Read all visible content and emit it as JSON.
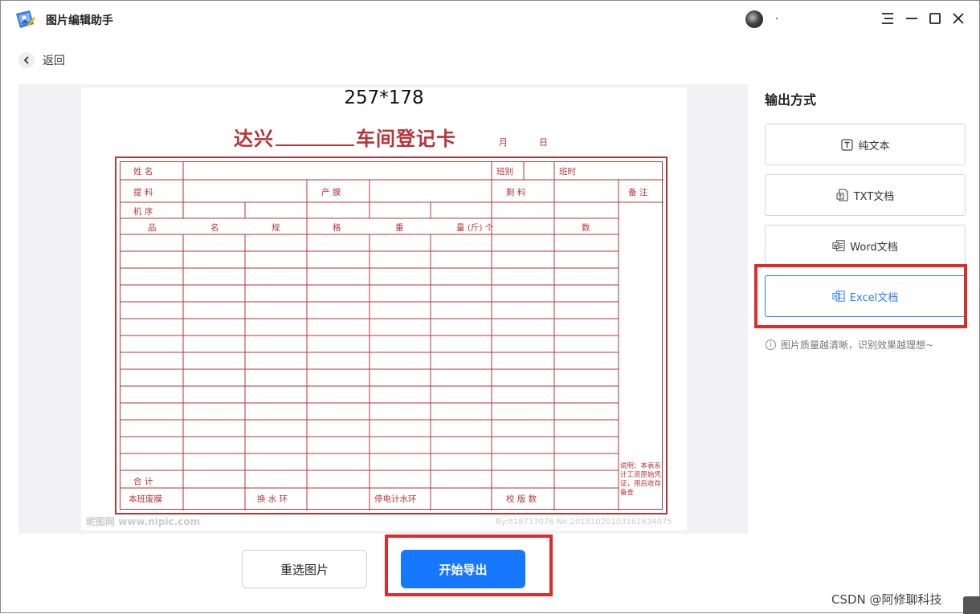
{
  "app": {
    "title": "图片编辑助手",
    "user_name": "."
  },
  "nav": {
    "back_label": "返回"
  },
  "document": {
    "dimensions": "257*178",
    "form_title_left": "达兴",
    "form_title_right": "车间登记卡",
    "month": "月",
    "day": "日",
    "labels": {
      "name": "姓 名",
      "shift": "班别",
      "team_hours": "班时",
      "material": "提 料",
      "output_film": "产 膜",
      "remaining": "剩 料",
      "remarks": "备 注",
      "machine_seq": "机 序",
      "product": "品",
      "name2": "名",
      "spec": "规",
      "format": "格",
      "weight": "重",
      "quantity": "量 (斤) 个",
      "count": "数",
      "total": "合 计",
      "waste_film": "本班废膜",
      "change_ring": "换 水 环",
      "power_cut": "停电计水环",
      "proof_count": "校 版 数",
      "note": "说明：本表系计工资原始凭证，用后收存备查"
    },
    "watermark_left": "昵图网 www.nipic.com",
    "watermark_right": "By:818717076 No.20181020103162634075"
  },
  "sidebar": {
    "title": "输出方式",
    "options": [
      {
        "label": "纯文本",
        "icon": "text-icon",
        "selected": false
      },
      {
        "label": "TXT文档",
        "icon": "txt-file-icon",
        "selected": false
      },
      {
        "label": "Word文档",
        "icon": "word-icon",
        "selected": false
      },
      {
        "label": "Excel文档",
        "icon": "excel-icon",
        "selected": true
      }
    ],
    "hint": "图片质量越清晰，识别效果越理想~"
  },
  "actions": {
    "reselect_label": "重选图片",
    "export_label": "开始导出"
  },
  "watermark": {
    "csdn": "CSDN @阿修聊科技"
  },
  "colors": {
    "accent": "#1677ff",
    "form_red": "#b3363a",
    "highlight_red": "#e02b2b"
  }
}
